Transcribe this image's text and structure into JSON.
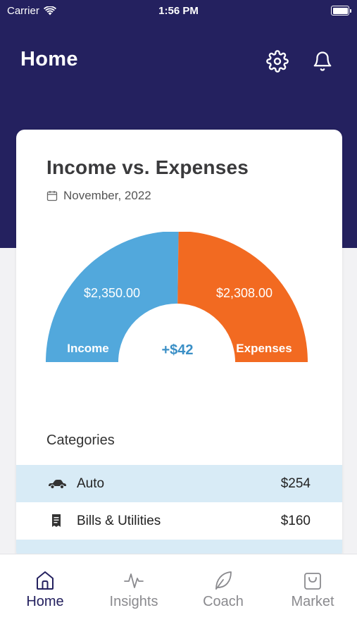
{
  "status_bar": {
    "carrier": "Carrier",
    "time": "1:56 PM"
  },
  "nav": {
    "title": "Home",
    "icons": [
      "gear-icon",
      "bell-icon"
    ]
  },
  "card": {
    "title": "Income vs. Expenses",
    "date": "November, 2022",
    "gauge": {
      "income_amount": "$2,350.00",
      "expenses_amount": "$2,308.00",
      "income_label": "Income",
      "expenses_label": "Expenses",
      "net": "+$42",
      "income_value": 2350,
      "expenses_value": 2308
    },
    "categories_label": "Categories",
    "categories": [
      {
        "name": "Auto",
        "amount": "$254",
        "icon": "car-icon"
      },
      {
        "name": "Bills & Utilities",
        "amount": "$160",
        "icon": "bill-icon"
      }
    ]
  },
  "tabs": [
    {
      "label": "Home",
      "icon": "home-icon",
      "active": true
    },
    {
      "label": "Insights",
      "icon": "pulse-icon",
      "active": false
    },
    {
      "label": "Coach",
      "icon": "leaf-icon",
      "active": false
    },
    {
      "label": "Market",
      "icon": "bag-icon",
      "active": false
    }
  ],
  "colors": {
    "header": "#24215f",
    "income": "#52a8dc",
    "expenses": "#f26a21",
    "net": "#3a8fc6",
    "row_highlight": "#d8ebf6"
  }
}
